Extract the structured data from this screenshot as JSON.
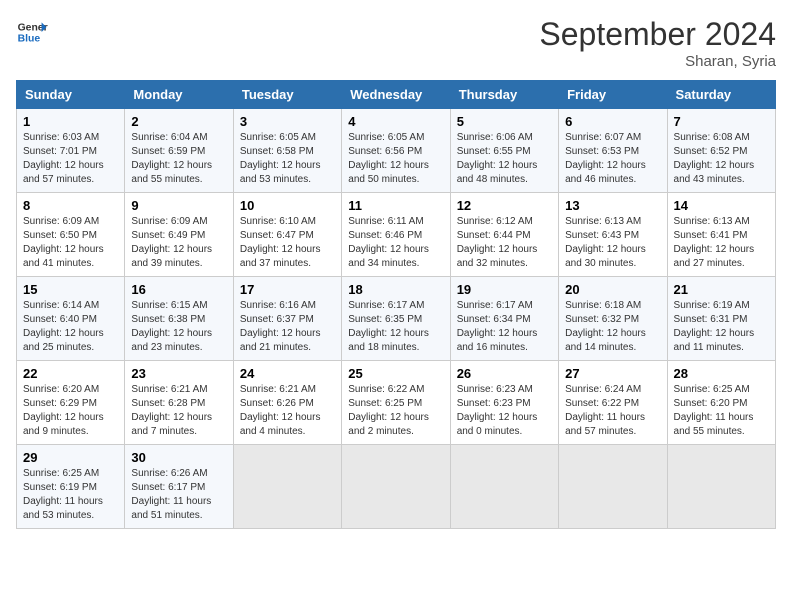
{
  "logo": {
    "text_general": "General",
    "text_blue": "Blue"
  },
  "title": {
    "month_year": "September 2024",
    "location": "Sharan, Syria"
  },
  "weekdays": [
    "Sunday",
    "Monday",
    "Tuesday",
    "Wednesday",
    "Thursday",
    "Friday",
    "Saturday"
  ],
  "weeks": [
    [
      {
        "day": "1",
        "sunrise": "6:03 AM",
        "sunset": "7:01 PM",
        "daylight": "12 hours and 57 minutes."
      },
      {
        "day": "2",
        "sunrise": "6:04 AM",
        "sunset": "6:59 PM",
        "daylight": "12 hours and 55 minutes."
      },
      {
        "day": "3",
        "sunrise": "6:05 AM",
        "sunset": "6:58 PM",
        "daylight": "12 hours and 53 minutes."
      },
      {
        "day": "4",
        "sunrise": "6:05 AM",
        "sunset": "6:56 PM",
        "daylight": "12 hours and 50 minutes."
      },
      {
        "day": "5",
        "sunrise": "6:06 AM",
        "sunset": "6:55 PM",
        "daylight": "12 hours and 48 minutes."
      },
      {
        "day": "6",
        "sunrise": "6:07 AM",
        "sunset": "6:53 PM",
        "daylight": "12 hours and 46 minutes."
      },
      {
        "day": "7",
        "sunrise": "6:08 AM",
        "sunset": "6:52 PM",
        "daylight": "12 hours and 43 minutes."
      }
    ],
    [
      {
        "day": "8",
        "sunrise": "6:09 AM",
        "sunset": "6:50 PM",
        "daylight": "12 hours and 41 minutes."
      },
      {
        "day": "9",
        "sunrise": "6:09 AM",
        "sunset": "6:49 PM",
        "daylight": "12 hours and 39 minutes."
      },
      {
        "day": "10",
        "sunrise": "6:10 AM",
        "sunset": "6:47 PM",
        "daylight": "12 hours and 37 minutes."
      },
      {
        "day": "11",
        "sunrise": "6:11 AM",
        "sunset": "6:46 PM",
        "daylight": "12 hours and 34 minutes."
      },
      {
        "day": "12",
        "sunrise": "6:12 AM",
        "sunset": "6:44 PM",
        "daylight": "12 hours and 32 minutes."
      },
      {
        "day": "13",
        "sunrise": "6:13 AM",
        "sunset": "6:43 PM",
        "daylight": "12 hours and 30 minutes."
      },
      {
        "day": "14",
        "sunrise": "6:13 AM",
        "sunset": "6:41 PM",
        "daylight": "12 hours and 27 minutes."
      }
    ],
    [
      {
        "day": "15",
        "sunrise": "6:14 AM",
        "sunset": "6:40 PM",
        "daylight": "12 hours and 25 minutes."
      },
      {
        "day": "16",
        "sunrise": "6:15 AM",
        "sunset": "6:38 PM",
        "daylight": "12 hours and 23 minutes."
      },
      {
        "day": "17",
        "sunrise": "6:16 AM",
        "sunset": "6:37 PM",
        "daylight": "12 hours and 21 minutes."
      },
      {
        "day": "18",
        "sunrise": "6:17 AM",
        "sunset": "6:35 PM",
        "daylight": "12 hours and 18 minutes."
      },
      {
        "day": "19",
        "sunrise": "6:17 AM",
        "sunset": "6:34 PM",
        "daylight": "12 hours and 16 minutes."
      },
      {
        "day": "20",
        "sunrise": "6:18 AM",
        "sunset": "6:32 PM",
        "daylight": "12 hours and 14 minutes."
      },
      {
        "day": "21",
        "sunrise": "6:19 AM",
        "sunset": "6:31 PM",
        "daylight": "12 hours and 11 minutes."
      }
    ],
    [
      {
        "day": "22",
        "sunrise": "6:20 AM",
        "sunset": "6:29 PM",
        "daylight": "12 hours and 9 minutes."
      },
      {
        "day": "23",
        "sunrise": "6:21 AM",
        "sunset": "6:28 PM",
        "daylight": "12 hours and 7 minutes."
      },
      {
        "day": "24",
        "sunrise": "6:21 AM",
        "sunset": "6:26 PM",
        "daylight": "12 hours and 4 minutes."
      },
      {
        "day": "25",
        "sunrise": "6:22 AM",
        "sunset": "6:25 PM",
        "daylight": "12 hours and 2 minutes."
      },
      {
        "day": "26",
        "sunrise": "6:23 AM",
        "sunset": "6:23 PM",
        "daylight": "12 hours and 0 minutes."
      },
      {
        "day": "27",
        "sunrise": "6:24 AM",
        "sunset": "6:22 PM",
        "daylight": "11 hours and 57 minutes."
      },
      {
        "day": "28",
        "sunrise": "6:25 AM",
        "sunset": "6:20 PM",
        "daylight": "11 hours and 55 minutes."
      }
    ],
    [
      {
        "day": "29",
        "sunrise": "6:25 AM",
        "sunset": "6:19 PM",
        "daylight": "11 hours and 53 minutes."
      },
      {
        "day": "30",
        "sunrise": "6:26 AM",
        "sunset": "6:17 PM",
        "daylight": "11 hours and 51 minutes."
      },
      null,
      null,
      null,
      null,
      null
    ]
  ]
}
